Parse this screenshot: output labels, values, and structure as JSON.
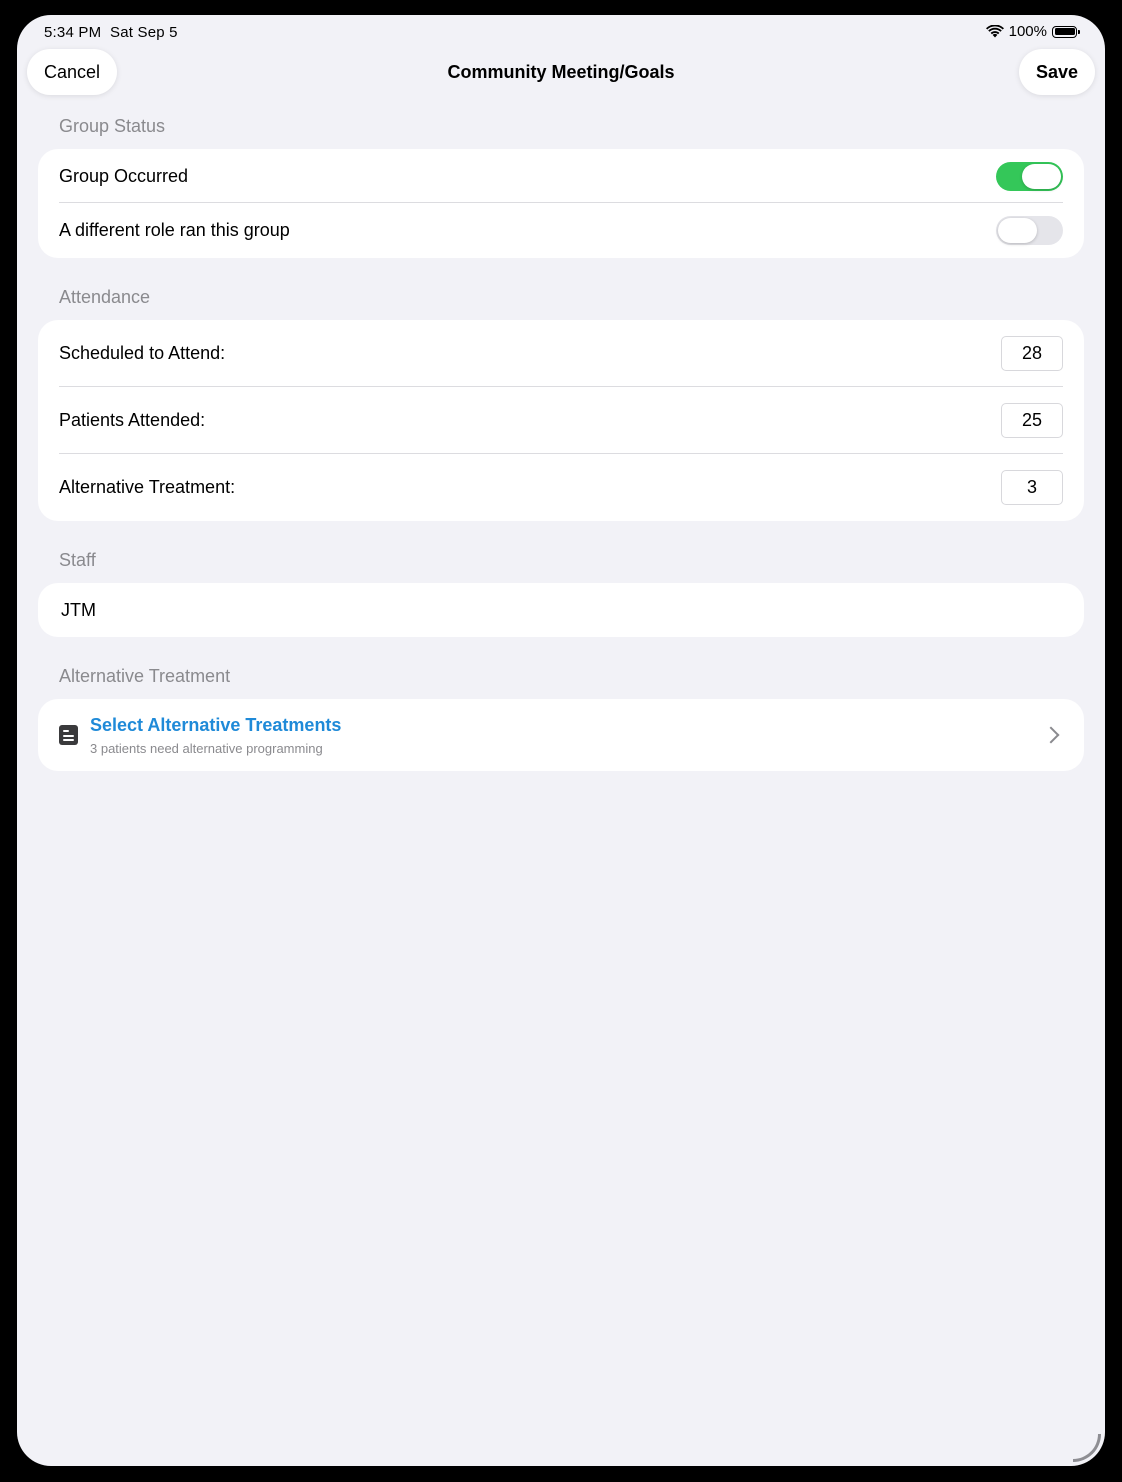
{
  "status_bar": {
    "time": "5:34 PM",
    "date": "Sat Sep 5",
    "battery": "100%",
    "icons": [
      "wifi-icon",
      "battery-icon"
    ]
  },
  "nav": {
    "cancel_label": "Cancel",
    "title": "Community Meeting/Goals",
    "save_label": "Save"
  },
  "group_status": {
    "header": "Group Status",
    "rows": [
      {
        "label": "Group Occurred",
        "on": true
      },
      {
        "label": "A different role ran this group",
        "on": false
      }
    ]
  },
  "attendance": {
    "header": "Attendance",
    "rows": [
      {
        "label": "Scheduled to Attend:",
        "value": "28"
      },
      {
        "label": "Patients Attended:",
        "value": "25"
      },
      {
        "label": "Alternative Treatment:",
        "value": "3"
      }
    ]
  },
  "staff": {
    "header": "Staff",
    "value": "JTM"
  },
  "alternative_treatment": {
    "header": "Alternative Treatment",
    "title": "Select Alternative Treatments",
    "subtitle": "3 patients need alternative programming",
    "icon": "list-icon",
    "chevron": "chevron-right-icon"
  },
  "colors": {
    "toggle_on": "#34c759",
    "toggle_off": "#e5e5ea",
    "link": "#1f8ad8",
    "background": "#f2f2f7",
    "secondary_text": "#8a8a8e"
  }
}
